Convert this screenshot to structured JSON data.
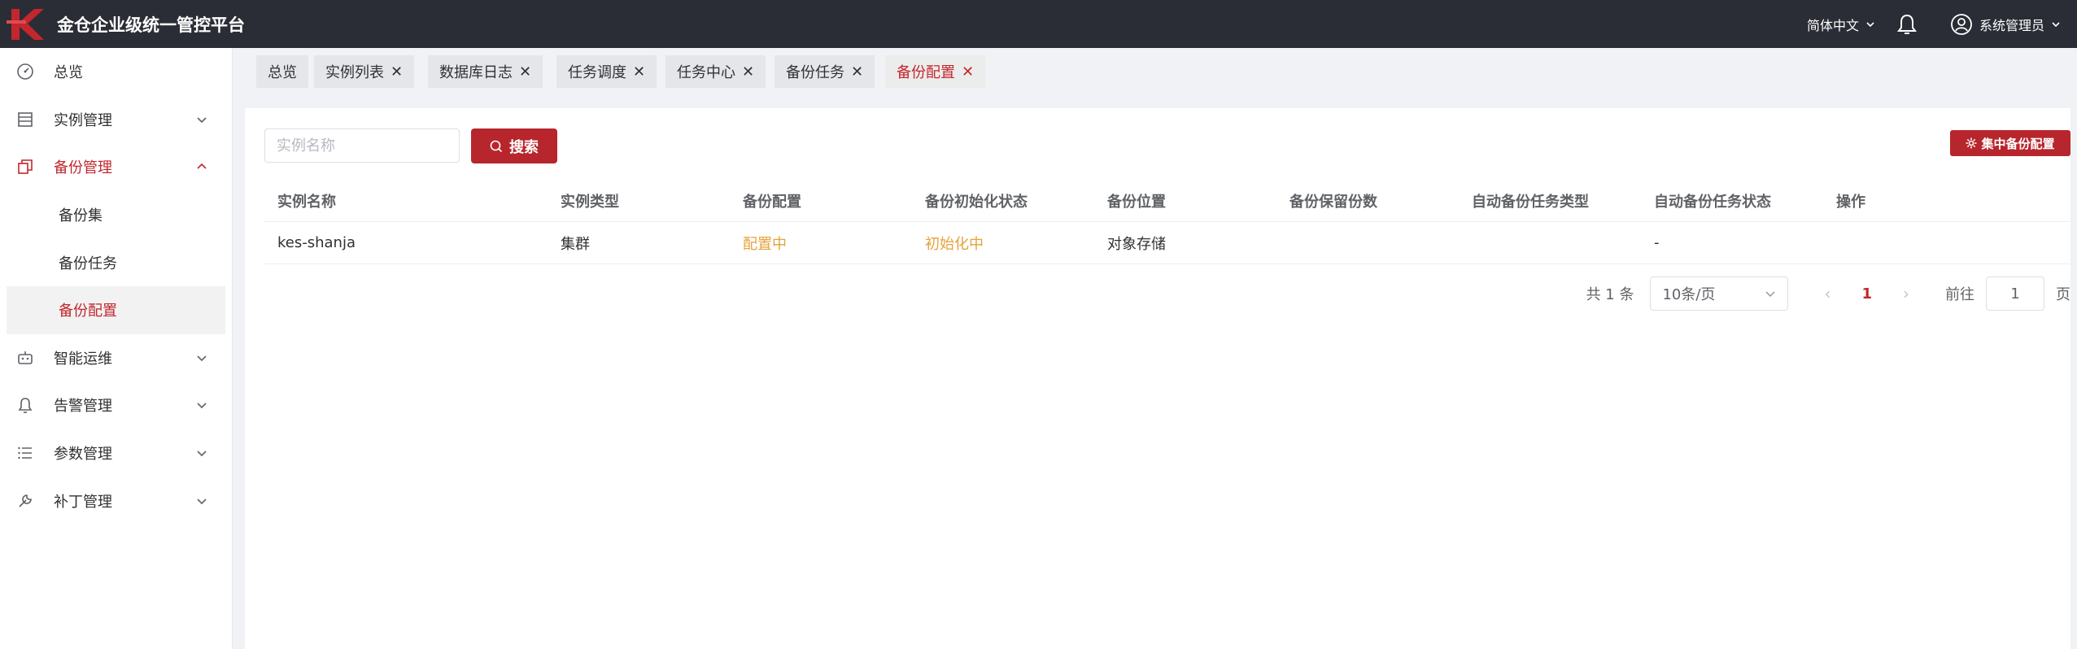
{
  "header": {
    "title": "金仓企业级统一管控平台",
    "language": "简体中文",
    "user": "系统管理员",
    "icons": [
      "kingbase-logo-icon",
      "chevron-down-icon",
      "bell-icon",
      "user-circle-icon"
    ]
  },
  "sidebar": {
    "items": [
      {
        "label": "总览",
        "icon": "dashboard-icon"
      },
      {
        "label": "实例管理",
        "icon": "database-list-icon"
      },
      {
        "label": "备份管理",
        "icon": "copy-icon"
      },
      {
        "label": "智能运维",
        "icon": "robot-icon"
      },
      {
        "label": "告警管理",
        "icon": "bell-icon"
      },
      {
        "label": "参数管理",
        "icon": "list-icon"
      },
      {
        "label": "补丁管理",
        "icon": "wrench-icon"
      }
    ],
    "backup_sub": [
      "备份集",
      "备份任务",
      "备份配置"
    ]
  },
  "tabs": [
    "总览",
    "实例列表",
    "数据库日志",
    "任务调度",
    "任务中心",
    "备份任务",
    "备份配置"
  ],
  "search": {
    "placeholder": "实例名称",
    "button": "搜索"
  },
  "central_button": "集中备份配置",
  "table": {
    "headers": [
      "实例名称",
      "实例类型",
      "备份配置",
      "备份初始化状态",
      "备份位置",
      "备份保留份数",
      "自动备份任务类型",
      "自动备份任务状态",
      "操作"
    ],
    "rows": [
      [
        "kes-shanja",
        "集群",
        "配置中",
        "初始化中",
        "对象存储",
        "",
        "",
        "-",
        ""
      ]
    ]
  },
  "pagination": {
    "total": "共 1 条",
    "page_size": "10条/页",
    "current": "1",
    "goto_label": "前往",
    "goto_value": "1",
    "page_suffix": "页"
  },
  "colors": {
    "accent": "#b7262c",
    "topbar": "#2a2d35",
    "warning": "#e6a23c"
  }
}
